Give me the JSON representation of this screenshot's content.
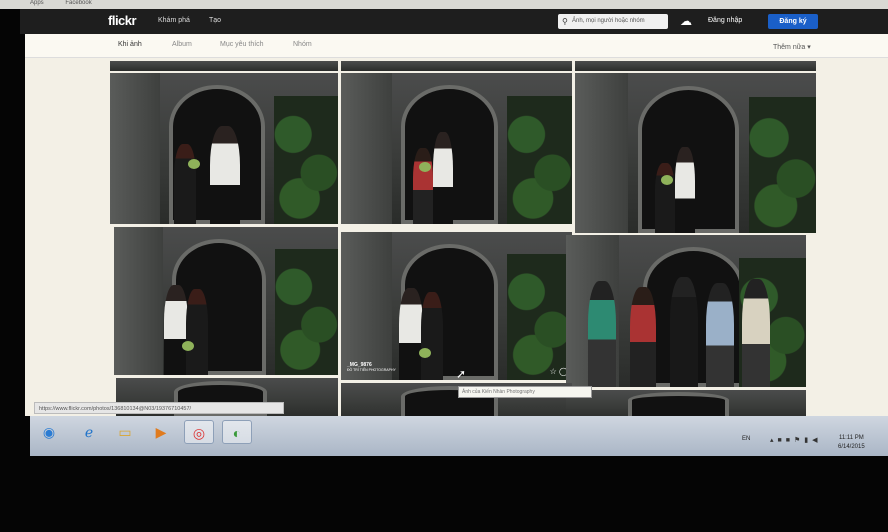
{
  "browser": {
    "bookmarks": [
      "Apps",
      "Facebook"
    ]
  },
  "flickr_nav": {
    "logo": "flickr",
    "links": [
      "Khám phá",
      "Tạo"
    ],
    "search_placeholder": "Ảnh, mọi người hoặc nhóm",
    "login": "Đăng nhập",
    "signup": "Đăng ký"
  },
  "subnav": {
    "tabs": [
      "Khi ảnh",
      "Album",
      "Mục yêu thích",
      "Nhóm"
    ],
    "more": "Thêm nữa ▾"
  },
  "photo_watermark": {
    "tag": "_MG_9876",
    "credit": "ĐỒ TRÍ TIẾN PHOTOGRAPHY"
  },
  "status_url": "https://www.flickr.com/photos/136810134@N03/19376710457/",
  "tooltip": "Ảnh của Kiến Nhàn Photography",
  "taskbar": {
    "language": "EN",
    "time": "11:11 PM",
    "date": "6/14/2015"
  },
  "colors": {
    "signup_button": "#1a5fc8",
    "nav_bg": "#1e1e1e",
    "page_bg": "#f3f0e6"
  }
}
